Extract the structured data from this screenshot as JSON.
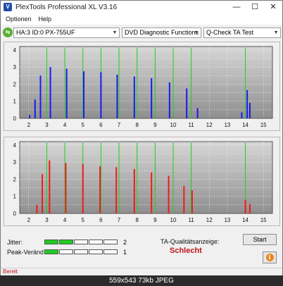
{
  "window": {
    "title": "PlexTools Professional XL V3.16",
    "icon_glyph": "V",
    "minimize_glyph": "—",
    "maximize_glyph": "☐",
    "close_glyph": "✕"
  },
  "menu": {
    "items": [
      "Optionen",
      "Help"
    ]
  },
  "toolbar": {
    "drive_icon_glyph": "⇆",
    "drive": "HA:3 ID:0  PX-755UF",
    "function": "DVD Diagnostic Functions",
    "test": "Q-Check TA Test",
    "arrow_glyph": "▼"
  },
  "colors": {
    "top_series": "#1a1aee",
    "bottom_series": "#ee1a1a",
    "grid_line": "#22cc22",
    "plot_bg_from": "#d6d6d6",
    "plot_bg_to": "#8f8f8f",
    "meter_on": "#22cc22",
    "result": "#c0141c"
  },
  "chart_data": [
    {
      "type": "bar",
      "series_color": "blue",
      "x_ticks": [
        2,
        3,
        4,
        5,
        6,
        7,
        8,
        9,
        10,
        11,
        12,
        13,
        14,
        15
      ],
      "y_ticks": [
        0,
        0.5,
        1,
        1.5,
        2,
        2.5,
        3,
        3.5,
        4
      ],
      "y_tick_labels": [
        "0",
        "",
        "1",
        "",
        "2",
        "",
        "3",
        "",
        "4"
      ],
      "xlim": [
        1.5,
        15.5
      ],
      "ylim": [
        0,
        4.2
      ],
      "grid_x": [
        3,
        4,
        5,
        6,
        7,
        8,
        9,
        10,
        11,
        14
      ],
      "peaks": [
        {
          "x": 2.05,
          "value": 0.2
        },
        {
          "x": 2.35,
          "value": 1.1
        },
        {
          "x": 2.65,
          "value": 2.5
        },
        {
          "x": 3.2,
          "value": 3.0
        },
        {
          "x": 4.1,
          "value": 2.9
        },
        {
          "x": 5.05,
          "value": 2.75
        },
        {
          "x": 6.0,
          "value": 2.7
        },
        {
          "x": 6.9,
          "value": 2.55
        },
        {
          "x": 7.85,
          "value": 2.45
        },
        {
          "x": 8.8,
          "value": 2.35
        },
        {
          "x": 9.8,
          "value": 2.1
        },
        {
          "x": 10.75,
          "value": 1.75
        },
        {
          "x": 11.35,
          "value": 0.6
        },
        {
          "x": 13.8,
          "value": 0.35
        },
        {
          "x": 14.1,
          "value": 1.65
        },
        {
          "x": 14.25,
          "value": 0.9
        }
      ]
    },
    {
      "type": "bar",
      "series_color": "red",
      "x_ticks": [
        2,
        3,
        4,
        5,
        6,
        7,
        8,
        9,
        10,
        11,
        12,
        13,
        14,
        15
      ],
      "y_ticks": [
        0,
        0.5,
        1,
        1.5,
        2,
        2.5,
        3,
        3.5,
        4
      ],
      "y_tick_labels": [
        "0",
        "",
        "1",
        "",
        "2",
        "",
        "3",
        "",
        "4"
      ],
      "xlim": [
        1.5,
        15.5
      ],
      "ylim": [
        0,
        4.2
      ],
      "grid_x": [
        3,
        4,
        5,
        6,
        7,
        8,
        9,
        10,
        11,
        14
      ],
      "peaks": [
        {
          "x": 2.45,
          "value": 0.5
        },
        {
          "x": 2.75,
          "value": 2.3
        },
        {
          "x": 3.15,
          "value": 3.1
        },
        {
          "x": 4.05,
          "value": 2.95
        },
        {
          "x": 5.0,
          "value": 2.9
        },
        {
          "x": 5.95,
          "value": 2.75
        },
        {
          "x": 6.85,
          "value": 2.7
        },
        {
          "x": 7.85,
          "value": 2.6
        },
        {
          "x": 8.8,
          "value": 2.4
        },
        {
          "x": 9.75,
          "value": 2.2
        },
        {
          "x": 10.6,
          "value": 1.6
        },
        {
          "x": 11.05,
          "value": 1.35
        },
        {
          "x": 14.0,
          "value": 0.8
        },
        {
          "x": 14.25,
          "value": 0.55
        }
      ]
    }
  ],
  "meters": [
    {
      "label": "Jitter:",
      "segments": 5,
      "filled": 2,
      "value": "2"
    },
    {
      "label": "Peak-Veränd",
      "segments": 5,
      "filled": 1,
      "value": "1"
    }
  ],
  "ta": {
    "label": "TA-Qualitätsanzeige:",
    "result": "Schlecht"
  },
  "buttons": {
    "start": "Start",
    "info_glyph": "i"
  },
  "status": {
    "text": "Bereit"
  },
  "caption": "559x543  73kb  JPEG"
}
